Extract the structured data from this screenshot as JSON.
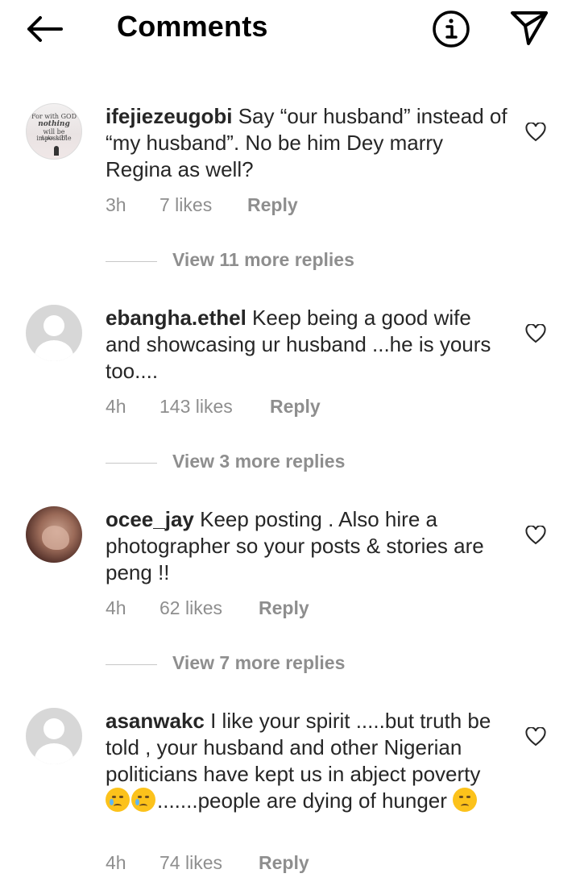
{
  "header": {
    "title": "Comments",
    "back_icon": "arrow-left-icon",
    "info_icon": "info-icon",
    "send_icon": "send-icon"
  },
  "comments": [
    {
      "username": "ifejiezeugobi",
      "text": " Say “our husband” instead of “my husband”. No be him Dey marry Regina as well?",
      "time": "3h",
      "likes": "7 likes",
      "reply": "Reply",
      "view_replies": "View 11 more replies",
      "avatar_text": [
        "For with GOD",
        "nothing",
        "will be impossible",
        "Luke 1:37"
      ]
    },
    {
      "username": "ebangha.ethel",
      "text": " Keep being a good wife and showcasing ur husband ...he is yours too....",
      "time": "4h",
      "likes": "143 likes",
      "reply": "Reply",
      "view_replies": "View 3 more replies"
    },
    {
      "username": "ocee_jay",
      "text": " Keep posting . Also hire a photographer so your posts & stories are peng !!",
      "time": "4h",
      "likes": "62 likes",
      "reply": "Reply",
      "view_replies": "View 7 more replies"
    },
    {
      "username": "asanwakc",
      "text_part1": " I like your spirit .....but truth be told , your husband and other Nigerian politicians have kept us in abject poverty ",
      "text_part2": ".......people are dying of hunger ",
      "time": "4h",
      "likes": "74 likes",
      "reply": "Reply"
    }
  ],
  "colors": {
    "text": "#262626",
    "secondary": "#8e8e8e",
    "divider": "#c7c7c7"
  }
}
